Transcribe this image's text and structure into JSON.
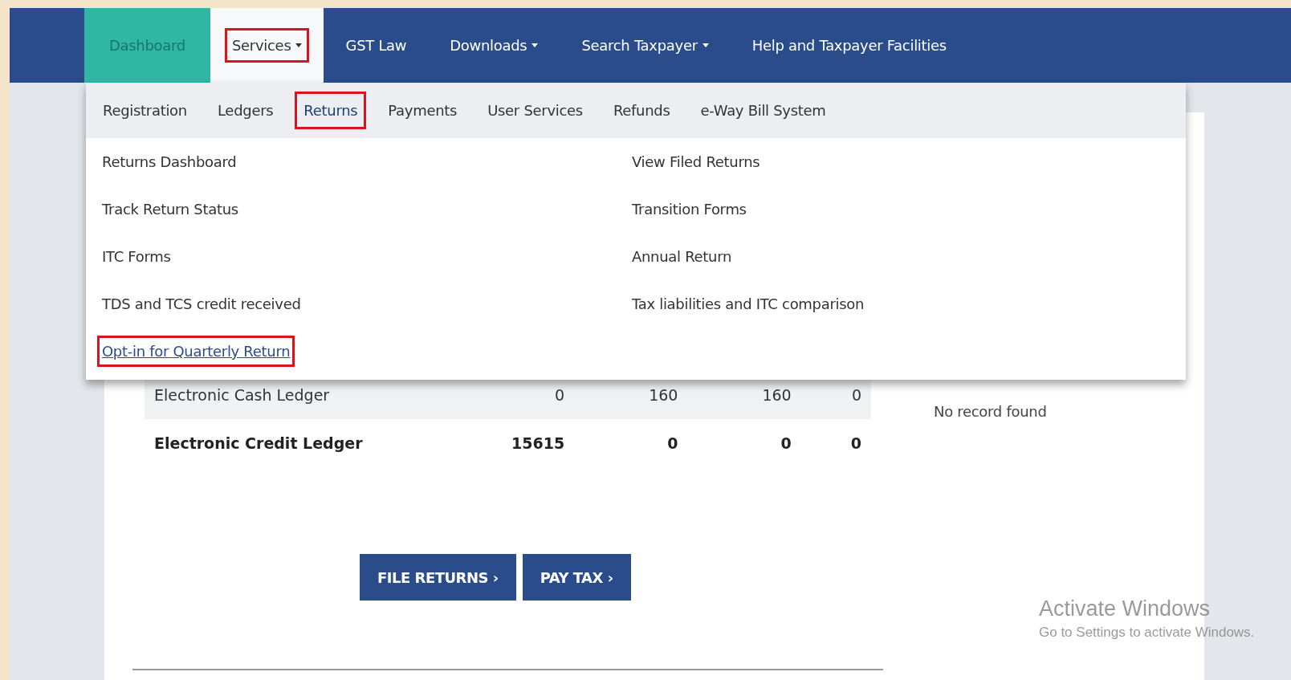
{
  "nav": {
    "items": [
      {
        "label": "Dashboard",
        "selected": true,
        "has_menu": false,
        "open": false,
        "highlighted": false
      },
      {
        "label": "Services",
        "selected": false,
        "has_menu": true,
        "open": true,
        "highlighted": true
      },
      {
        "label": "GST Law",
        "selected": false,
        "has_menu": false,
        "open": false,
        "highlighted": false
      },
      {
        "label": "Downloads",
        "selected": false,
        "has_menu": true,
        "open": false,
        "highlighted": false
      },
      {
        "label": "Search Taxpayer",
        "selected": false,
        "has_menu": true,
        "open": false,
        "highlighted": false
      },
      {
        "label": "Help and Taxpayer Facilities",
        "selected": false,
        "has_menu": false,
        "open": false,
        "highlighted": false
      }
    ]
  },
  "submenu": {
    "items": [
      {
        "label": "Registration",
        "selected": false,
        "highlighted": false
      },
      {
        "label": "Ledgers",
        "selected": false,
        "highlighted": false
      },
      {
        "label": "Returns",
        "selected": true,
        "highlighted": true
      },
      {
        "label": "Payments",
        "selected": false,
        "highlighted": false
      },
      {
        "label": "User Services",
        "selected": false,
        "highlighted": false
      },
      {
        "label": "Refunds",
        "selected": false,
        "highlighted": false
      },
      {
        "label": "e-Way Bill System",
        "selected": false,
        "highlighted": false
      }
    ]
  },
  "menu_links": {
    "left": [
      {
        "label": "Returns Dashboard",
        "hovered": false,
        "highlighted": false
      },
      {
        "label": "Track Return Status",
        "hovered": false,
        "highlighted": false
      },
      {
        "label": "ITC Forms",
        "hovered": false,
        "highlighted": false
      },
      {
        "label": "TDS and TCS credit received",
        "hovered": false,
        "highlighted": false
      },
      {
        "label": "Opt-in for Quarterly Return",
        "hovered": true,
        "highlighted": true
      }
    ],
    "right": [
      {
        "label": "View Filed Returns",
        "hovered": false,
        "highlighted": false
      },
      {
        "label": "Transition Forms",
        "hovered": false,
        "highlighted": false
      },
      {
        "label": "Annual Return",
        "hovered": false,
        "highlighted": false
      },
      {
        "label": "Tax liabilities and ITC comparison",
        "hovered": false,
        "highlighted": false
      }
    ]
  },
  "ledger_table": {
    "rows": [
      {
        "label": "Electronic Cash Ledger",
        "values": [
          "0",
          "160",
          "160",
          "0"
        ],
        "striped": true,
        "bold": false
      },
      {
        "label": "Electronic Credit Ledger",
        "values": [
          "15615",
          "0",
          "0",
          "0"
        ],
        "striped": false,
        "bold": true
      }
    ]
  },
  "notice": "No record found",
  "actions": [
    {
      "label": "FILE RETURNS ›"
    },
    {
      "label": "PAY TAX ›"
    }
  ],
  "os_watermark": {
    "title": "Activate Windows",
    "text": "Go to Settings to activate Windows."
  }
}
